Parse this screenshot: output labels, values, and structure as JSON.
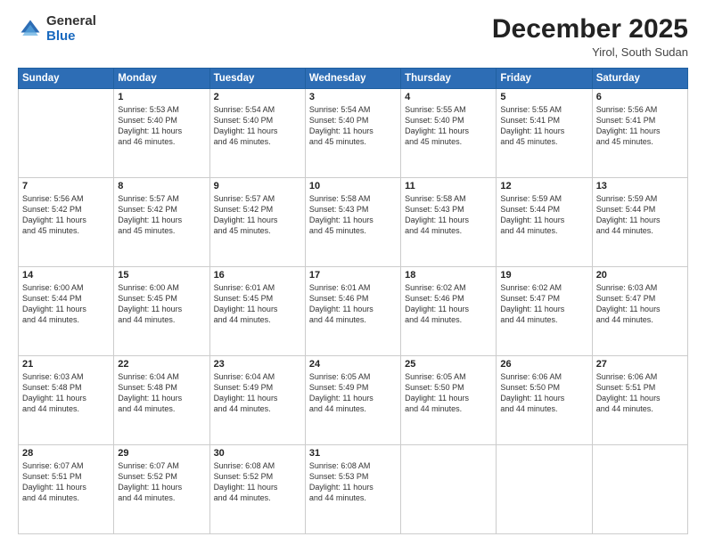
{
  "header": {
    "logo_general": "General",
    "logo_blue": "Blue",
    "month": "December 2025",
    "location": "Yirol, South Sudan"
  },
  "days_of_week": [
    "Sunday",
    "Monday",
    "Tuesday",
    "Wednesday",
    "Thursday",
    "Friday",
    "Saturday"
  ],
  "weeks": [
    [
      {
        "day": "",
        "content": ""
      },
      {
        "day": "1",
        "content": "Sunrise: 5:53 AM\nSunset: 5:40 PM\nDaylight: 11 hours\nand 46 minutes."
      },
      {
        "day": "2",
        "content": "Sunrise: 5:54 AM\nSunset: 5:40 PM\nDaylight: 11 hours\nand 46 minutes."
      },
      {
        "day": "3",
        "content": "Sunrise: 5:54 AM\nSunset: 5:40 PM\nDaylight: 11 hours\nand 45 minutes."
      },
      {
        "day": "4",
        "content": "Sunrise: 5:55 AM\nSunset: 5:40 PM\nDaylight: 11 hours\nand 45 minutes."
      },
      {
        "day": "5",
        "content": "Sunrise: 5:55 AM\nSunset: 5:41 PM\nDaylight: 11 hours\nand 45 minutes."
      },
      {
        "day": "6",
        "content": "Sunrise: 5:56 AM\nSunset: 5:41 PM\nDaylight: 11 hours\nand 45 minutes."
      }
    ],
    [
      {
        "day": "7",
        "content": "Sunrise: 5:56 AM\nSunset: 5:42 PM\nDaylight: 11 hours\nand 45 minutes."
      },
      {
        "day": "8",
        "content": "Sunrise: 5:57 AM\nSunset: 5:42 PM\nDaylight: 11 hours\nand 45 minutes."
      },
      {
        "day": "9",
        "content": "Sunrise: 5:57 AM\nSunset: 5:42 PM\nDaylight: 11 hours\nand 45 minutes."
      },
      {
        "day": "10",
        "content": "Sunrise: 5:58 AM\nSunset: 5:43 PM\nDaylight: 11 hours\nand 45 minutes."
      },
      {
        "day": "11",
        "content": "Sunrise: 5:58 AM\nSunset: 5:43 PM\nDaylight: 11 hours\nand 44 minutes."
      },
      {
        "day": "12",
        "content": "Sunrise: 5:59 AM\nSunset: 5:44 PM\nDaylight: 11 hours\nand 44 minutes."
      },
      {
        "day": "13",
        "content": "Sunrise: 5:59 AM\nSunset: 5:44 PM\nDaylight: 11 hours\nand 44 minutes."
      }
    ],
    [
      {
        "day": "14",
        "content": "Sunrise: 6:00 AM\nSunset: 5:44 PM\nDaylight: 11 hours\nand 44 minutes."
      },
      {
        "day": "15",
        "content": "Sunrise: 6:00 AM\nSunset: 5:45 PM\nDaylight: 11 hours\nand 44 minutes."
      },
      {
        "day": "16",
        "content": "Sunrise: 6:01 AM\nSunset: 5:45 PM\nDaylight: 11 hours\nand 44 minutes."
      },
      {
        "day": "17",
        "content": "Sunrise: 6:01 AM\nSunset: 5:46 PM\nDaylight: 11 hours\nand 44 minutes."
      },
      {
        "day": "18",
        "content": "Sunrise: 6:02 AM\nSunset: 5:46 PM\nDaylight: 11 hours\nand 44 minutes."
      },
      {
        "day": "19",
        "content": "Sunrise: 6:02 AM\nSunset: 5:47 PM\nDaylight: 11 hours\nand 44 minutes."
      },
      {
        "day": "20",
        "content": "Sunrise: 6:03 AM\nSunset: 5:47 PM\nDaylight: 11 hours\nand 44 minutes."
      }
    ],
    [
      {
        "day": "21",
        "content": "Sunrise: 6:03 AM\nSunset: 5:48 PM\nDaylight: 11 hours\nand 44 minutes."
      },
      {
        "day": "22",
        "content": "Sunrise: 6:04 AM\nSunset: 5:48 PM\nDaylight: 11 hours\nand 44 minutes."
      },
      {
        "day": "23",
        "content": "Sunrise: 6:04 AM\nSunset: 5:49 PM\nDaylight: 11 hours\nand 44 minutes."
      },
      {
        "day": "24",
        "content": "Sunrise: 6:05 AM\nSunset: 5:49 PM\nDaylight: 11 hours\nand 44 minutes."
      },
      {
        "day": "25",
        "content": "Sunrise: 6:05 AM\nSunset: 5:50 PM\nDaylight: 11 hours\nand 44 minutes."
      },
      {
        "day": "26",
        "content": "Sunrise: 6:06 AM\nSunset: 5:50 PM\nDaylight: 11 hours\nand 44 minutes."
      },
      {
        "day": "27",
        "content": "Sunrise: 6:06 AM\nSunset: 5:51 PM\nDaylight: 11 hours\nand 44 minutes."
      }
    ],
    [
      {
        "day": "28",
        "content": "Sunrise: 6:07 AM\nSunset: 5:51 PM\nDaylight: 11 hours\nand 44 minutes."
      },
      {
        "day": "29",
        "content": "Sunrise: 6:07 AM\nSunset: 5:52 PM\nDaylight: 11 hours\nand 44 minutes."
      },
      {
        "day": "30",
        "content": "Sunrise: 6:08 AM\nSunset: 5:52 PM\nDaylight: 11 hours\nand 44 minutes."
      },
      {
        "day": "31",
        "content": "Sunrise: 6:08 AM\nSunset: 5:53 PM\nDaylight: 11 hours\nand 44 minutes."
      },
      {
        "day": "",
        "content": ""
      },
      {
        "day": "",
        "content": ""
      },
      {
        "day": "",
        "content": ""
      }
    ]
  ]
}
